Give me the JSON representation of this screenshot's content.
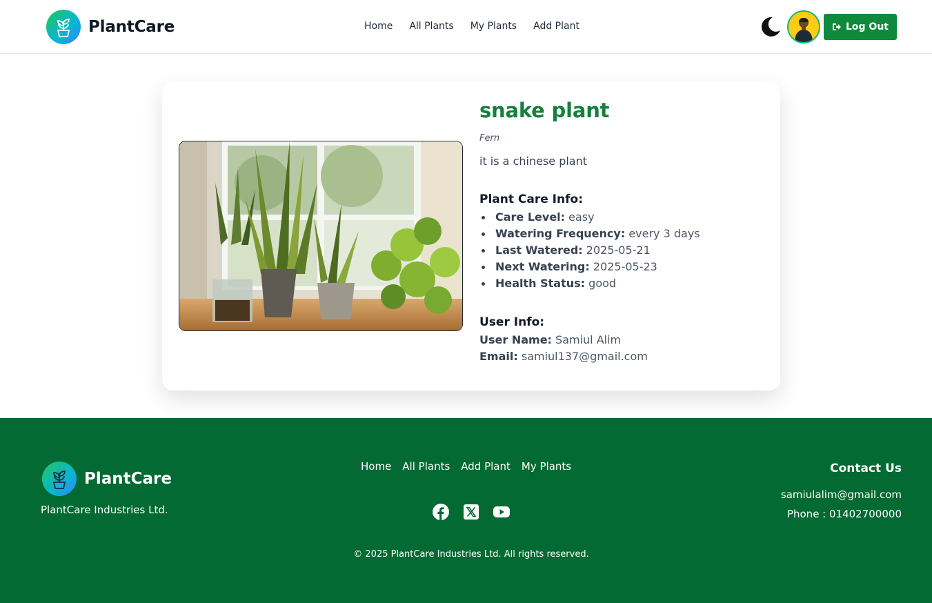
{
  "navbar": {
    "brand": "PlantCare",
    "links": [
      "Home",
      "All Plants",
      "My Plants",
      "Add Plant"
    ],
    "logout_label": "Log Out"
  },
  "plant": {
    "name": "snake plant",
    "category": "Fern",
    "description": "it is a chinese plant",
    "care_title": "Plant Care Info:",
    "care": [
      {
        "label": "Care Level:",
        "value": "easy"
      },
      {
        "label": "Watering Frequency:",
        "value": "every 3 days"
      },
      {
        "label": "Last Watered:",
        "value": "2025-05-21"
      },
      {
        "label": "Next Watering:",
        "value": "2025-05-23"
      },
      {
        "label": "Health Status:",
        "value": "good"
      }
    ],
    "user_title": "User Info:",
    "user": [
      {
        "label": "User Name:",
        "value": "Samiul Alim"
      },
      {
        "label": "Email:",
        "value": "samiul137@gmail.com"
      }
    ]
  },
  "footer": {
    "brand": "PlantCare",
    "tagline": "PlantCare Industries Ltd.",
    "links": [
      "Home",
      "All Plants",
      "Add Plant",
      "My Plants"
    ],
    "social_icons": [
      "facebook-icon",
      "x-icon",
      "youtube-icon"
    ],
    "contact_title": "Contact Us",
    "email": "samiulalim@gmail.com",
    "phone": "Phone : 01402700000",
    "copyright": "© 2025 PlantCare Industries Ltd. All rights reserved."
  },
  "colors": {
    "brand_green": "#15803d",
    "button_green": "#0f8a3c",
    "footer_green": "#046a33"
  }
}
